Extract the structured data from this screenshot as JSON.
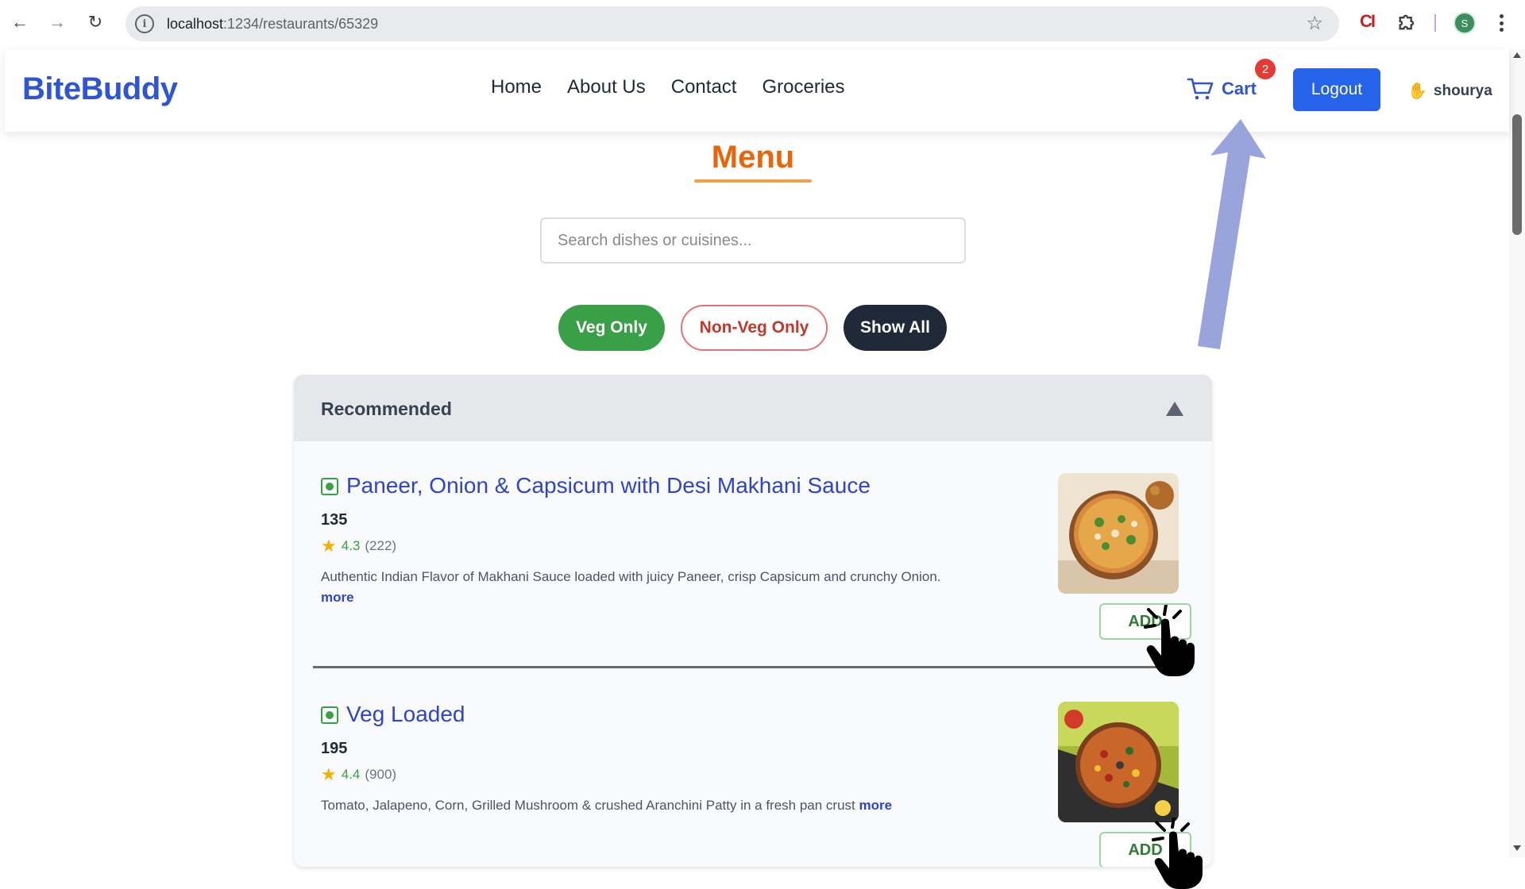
{
  "browser": {
    "url_host": "localhost",
    "url_path": ":1234/restaurants/65329",
    "extension_label": "CI",
    "profile_initial": "S"
  },
  "header": {
    "brand": "BiteBuddy",
    "nav": [
      "Home",
      "About Us",
      "Contact",
      "Groceries"
    ],
    "cart_label": "Cart",
    "cart_count": "2",
    "logout_label": "Logout",
    "user_name": "shourya"
  },
  "menu": {
    "title": "Menu",
    "search_placeholder": "Search dishes or cuisines...",
    "filters": {
      "veg": "Veg Only",
      "nonveg": "Non-Veg Only",
      "all": "Show All"
    },
    "section": {
      "title": "Recommended",
      "items": [
        {
          "name": "Paneer, Onion & Capsicum with Desi Makhani Sauce",
          "price": "135",
          "rating": "4.3",
          "rating_count": "(222)",
          "description": "Authentic Indian Flavor of Makhani Sauce loaded with juicy Paneer, crisp Capsicum and crunchy Onion.",
          "more_label": "more",
          "add_label": "ADD"
        },
        {
          "name": "Veg Loaded",
          "price": "195",
          "rating": "4.4",
          "rating_count": "(900)",
          "description": "Tomato, Jalapeno, Corn, Grilled Mushroom & crushed Aranchini Patty in a fresh pan crust",
          "more_label": "more",
          "add_label": "ADD"
        }
      ]
    }
  },
  "colors": {
    "brand": "#2f54d4",
    "menu_title": "#e8650a",
    "veg_green": "#3aa047",
    "nonveg_red": "#c0392b",
    "logout_blue": "#2563eb",
    "annotation_arrow": "#8e9ad8"
  },
  "icons": {
    "back": "arrow-left-icon",
    "forward": "arrow-right-icon",
    "reload": "reload-icon",
    "site_info": "info-icon",
    "bookmark": "star-outline-icon",
    "extensions": "puzzle-icon",
    "menu": "kebab-icon",
    "cart": "cart-icon",
    "user": "wave-hand-icon",
    "collapse": "caret-up-icon",
    "veg": "veg-indicator-icon",
    "rating": "star-icon",
    "cursor": "pointer-hand-icon",
    "annotation": "annotation-arrow-icon"
  }
}
